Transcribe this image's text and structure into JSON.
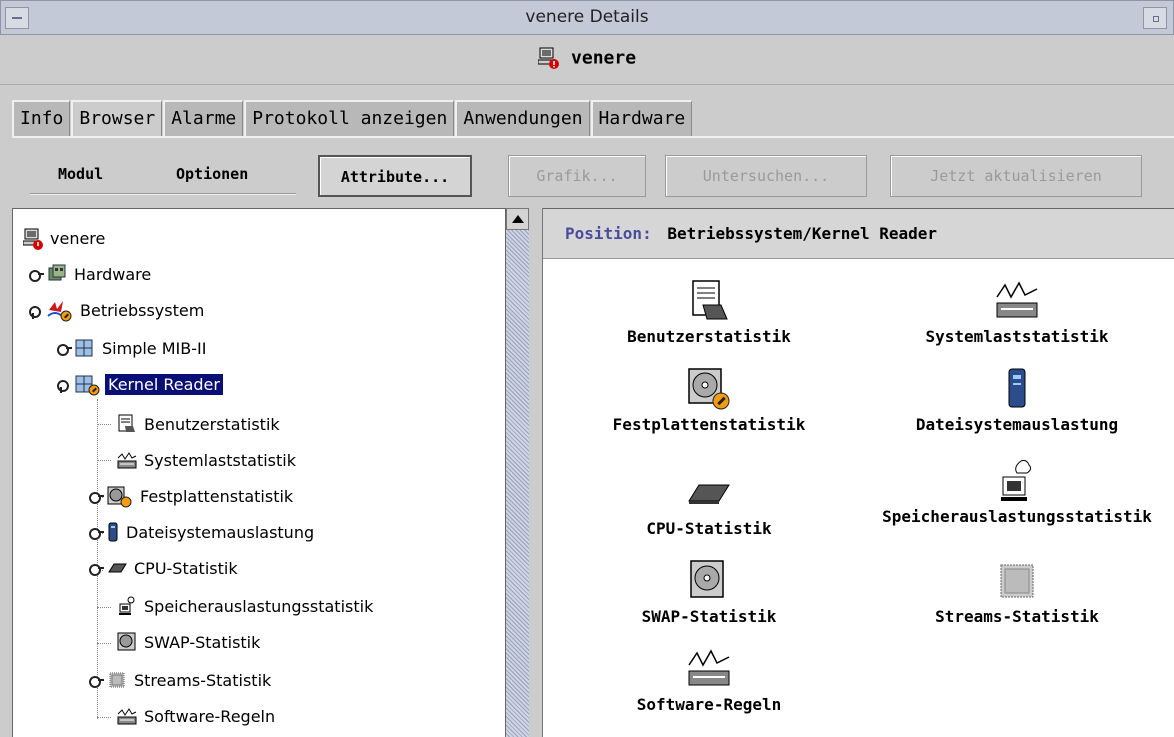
{
  "window": {
    "title": "venere Details"
  },
  "header": {
    "hostname": "venere"
  },
  "tabs": [
    {
      "label": "Info"
    },
    {
      "label": "Browser"
    },
    {
      "label": "Alarme"
    },
    {
      "label": "Protokoll anzeigen"
    },
    {
      "label": "Anwendungen"
    },
    {
      "label": "Hardware"
    }
  ],
  "toolbar": {
    "menu_modul": "Modul",
    "menu_optionen": "Optionen",
    "attribute_label": "Attribute...",
    "grafik_label": "Grafik...",
    "untersuchen_label": "Untersuchen...",
    "aktualisieren_label": "Jetzt aktualisieren"
  },
  "tree": {
    "root": "venere",
    "hardware": "Hardware",
    "betriebssystem": "Betriebssystem",
    "simple_mib": "Simple MIB-II",
    "kernel_reader": "Kernel Reader",
    "children": [
      {
        "label": "Benutzerstatistik"
      },
      {
        "label": "Systemlaststatistik"
      },
      {
        "label": "Festplattenstatistik"
      },
      {
        "label": "Dateisystemauslastung"
      },
      {
        "label": "CPU-Statistik"
      },
      {
        "label": "Speicherauslastungsstatistik"
      },
      {
        "label": "SWAP-Statistik"
      },
      {
        "label": "Streams-Statistik"
      },
      {
        "label": "Software-Regeln"
      }
    ]
  },
  "content": {
    "position_label": "Position:",
    "position_path": "Betriebssystem/Kernel Reader",
    "items": [
      {
        "label": "Benutzerstatistik",
        "icon": "user-stats-icon"
      },
      {
        "label": "Systemlaststatistik",
        "icon": "system-load-icon"
      },
      {
        "label": "Festplattenstatistik",
        "icon": "disk-icon"
      },
      {
        "label": "Dateisystemauslastung",
        "icon": "filesystem-icon"
      },
      {
        "label": "CPU-Statistik",
        "icon": "cpu-chip-icon"
      },
      {
        "label": "Speicherauslastungsstatistik",
        "icon": "memory-icon"
      },
      {
        "label": "SWAP-Statistik",
        "icon": "swap-disk-icon"
      },
      {
        "label": "Streams-Statistik",
        "icon": "streams-chip-icon"
      },
      {
        "label": "Software-Regeln",
        "icon": "software-rules-icon"
      }
    ]
  },
  "colors": {
    "selection": "#0a0f76",
    "position_label": "#4b4b9b",
    "alarm_red": "#d40000",
    "warning_orange": "#f39c12"
  }
}
